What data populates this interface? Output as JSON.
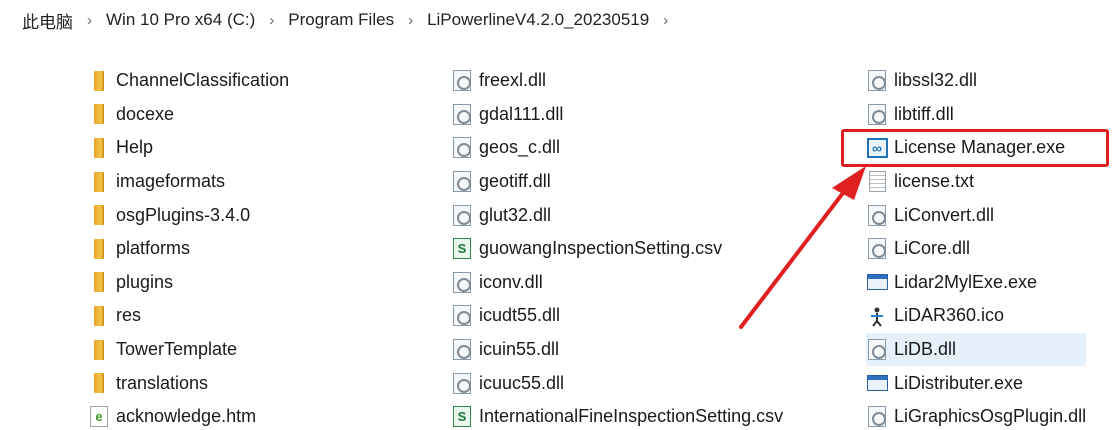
{
  "breadcrumb": {
    "items": [
      "此电脑",
      "Win 10 Pro x64 (C:)",
      "Program Files",
      "LiPowerlineV4.2.0_20230519"
    ],
    "separator": "›"
  },
  "columns": [
    [
      {
        "name": "ChannelClassification",
        "icon": "folder-icon"
      },
      {
        "name": "docexe",
        "icon": "folder-icon"
      },
      {
        "name": "Help",
        "icon": "folder-icon"
      },
      {
        "name": "imageformats",
        "icon": "folder-icon"
      },
      {
        "name": "osgPlugins-3.4.0",
        "icon": "folder-icon"
      },
      {
        "name": "platforms",
        "icon": "folder-icon"
      },
      {
        "name": "plugins",
        "icon": "folder-icon"
      },
      {
        "name": "res",
        "icon": "folder-icon"
      },
      {
        "name": "TowerTemplate",
        "icon": "folder-icon"
      },
      {
        "name": "translations",
        "icon": "folder-icon"
      },
      {
        "name": "acknowledge.htm",
        "icon": "htm-file-icon"
      }
    ],
    [
      {
        "name": "freexl.dll",
        "icon": "dll-file-icon"
      },
      {
        "name": "gdal111.dll",
        "icon": "dll-file-icon"
      },
      {
        "name": "geos_c.dll",
        "icon": "dll-file-icon"
      },
      {
        "name": "geotiff.dll",
        "icon": "dll-file-icon"
      },
      {
        "name": "glut32.dll",
        "icon": "dll-file-icon"
      },
      {
        "name": "guowangInspectionSetting.csv",
        "icon": "csv-file-icon"
      },
      {
        "name": "iconv.dll",
        "icon": "dll-file-icon"
      },
      {
        "name": "icudt55.dll",
        "icon": "dll-file-icon"
      },
      {
        "name": "icuin55.dll",
        "icon": "dll-file-icon"
      },
      {
        "name": "icuuc55.dll",
        "icon": "dll-file-icon"
      },
      {
        "name": "InternationalFineInspectionSetting.csv",
        "icon": "csv-file-icon"
      }
    ],
    [
      {
        "name": "libssl32.dll",
        "icon": "dll-file-icon"
      },
      {
        "name": "libtiff.dll",
        "icon": "dll-file-icon"
      },
      {
        "name": "License Manager.exe",
        "icon": "license-manager-icon"
      },
      {
        "name": "license.txt",
        "icon": "txt-file-icon"
      },
      {
        "name": "LiConvert.dll",
        "icon": "dll-file-icon"
      },
      {
        "name": "LiCore.dll",
        "icon": "dll-file-icon"
      },
      {
        "name": "Lidar2MylExe.exe",
        "icon": "exe-file-icon"
      },
      {
        "name": "LiDAR360.ico",
        "icon": "ico-file-icon"
      },
      {
        "name": "LiDB.dll",
        "icon": "dll-file-icon"
      },
      {
        "name": "LiDistributer.exe",
        "icon": "exe-file-icon"
      },
      {
        "name": "LiGraphicsOsgPlugin.dll",
        "icon": "dll-file-icon"
      }
    ]
  ],
  "selected_item": "LiDB.dll",
  "highlighted_item": "License Manager.exe",
  "colors": {
    "highlight": "#e02020",
    "selection": "#e5f0fb"
  }
}
